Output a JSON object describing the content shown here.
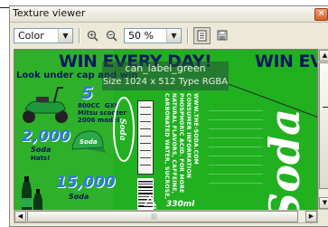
{
  "window": {
    "title": "Texture viewer"
  },
  "toolbar": {
    "channel": "Color",
    "zoom": "50 %",
    "icons": [
      "zoom-in-icon",
      "zoom-out-icon",
      "info-icon",
      "save-icon"
    ]
  },
  "overlay": {
    "name": "can_label_green",
    "size": "Size 1024 x 512  Type RGBA"
  },
  "texture": {
    "headline_left": "WIN EVERY DAY!",
    "headline_right": "WIN EV",
    "look": "Look under cap  and win",
    "prize1_num": "5",
    "prize1_text": "800CC  GXI\nMitsu scooter\n2006 model",
    "prize2_num": "2,000",
    "prize2_brand": "Soda",
    "prize2_text": "Hats!",
    "prize3_num": "15,000",
    "prize3_brand": "Soda",
    "volume": "330ml",
    "brand": "Soda",
    "brand_small": "Soda",
    "ingredients": [
      "CARBONATED WATER, SUCROSE,",
      "NATURAL FLAVORS, CAFFEINE,",
      "PHOSPHORIC ACID. FOR MORE",
      "CONSUMER INFORMATION",
      "WWW.THE-SODA.COM"
    ]
  },
  "colors": {
    "label_green": "#20b020",
    "headline": "#0a1a5a",
    "accent_blue": "#2a7ad8"
  }
}
